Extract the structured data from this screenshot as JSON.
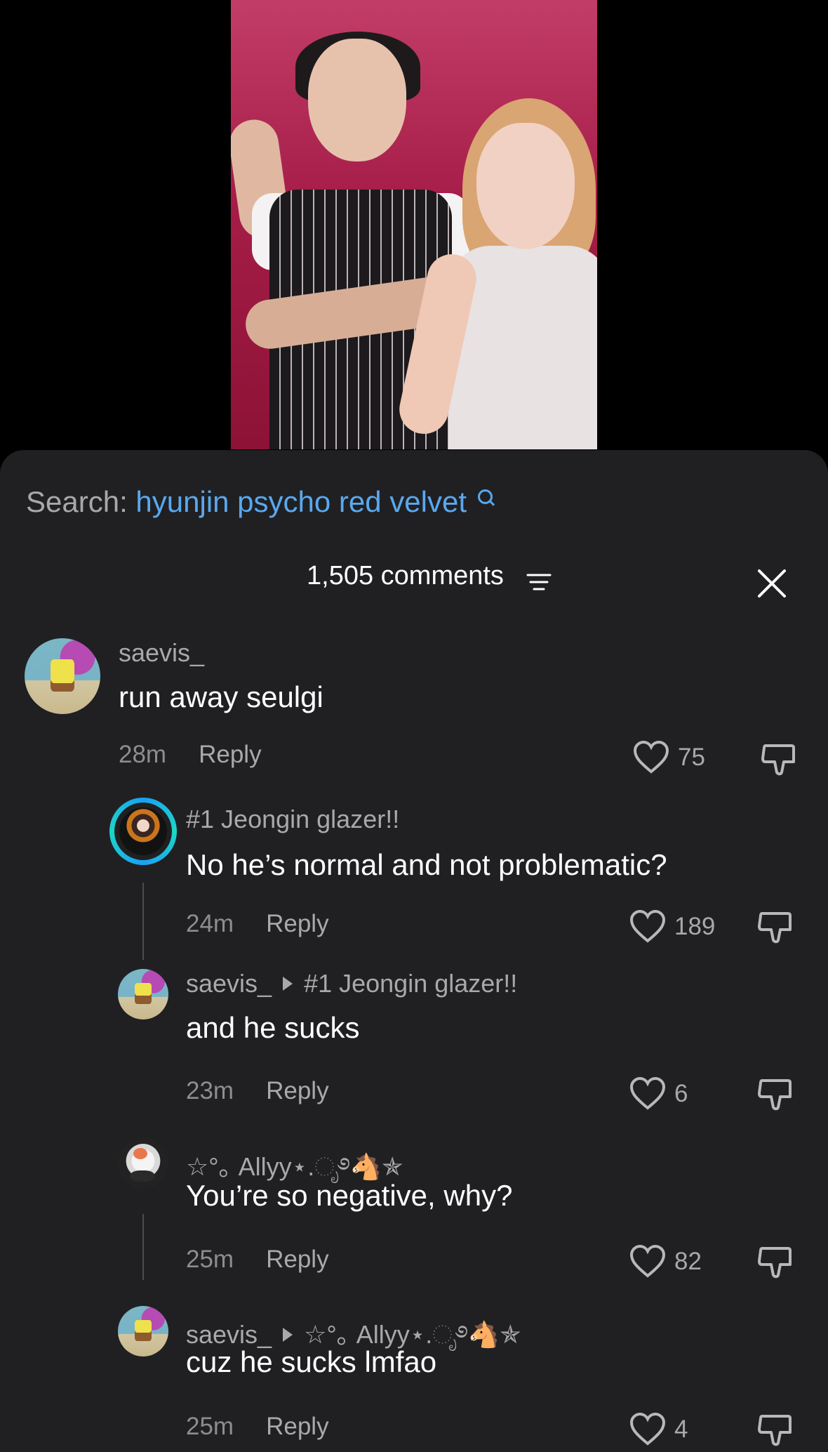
{
  "search": {
    "prefix": "Search:",
    "query": "hyunjin psycho red velvet"
  },
  "header": {
    "count": "1,505 comments"
  },
  "comments": [
    {
      "username": "saevis_",
      "text": "run away seulgi",
      "time": "28m",
      "reply": "Reply",
      "likes": "75"
    },
    {
      "username": "#1 Jeongin glazer!!",
      "text": "No he’s normal and not problematic?",
      "time": "24m",
      "reply": "Reply",
      "likes": "189"
    },
    {
      "username": "saevis_",
      "reply_to": "#1 Jeongin glazer!!",
      "text": "and he sucks",
      "time": "23m",
      "reply": "Reply",
      "likes": "6"
    },
    {
      "username": "☆°｡ Allyy⋆.ೃ࿔🐴✯",
      "text": "You’re so negative, why?",
      "time": "25m",
      "reply": "Reply",
      "likes": "82"
    },
    {
      "username": "saevis_",
      "reply_to": "☆°｡ Allyy⋆.ೃ࿔🐴✯",
      "text": "cuz he sucks lmfao",
      "time": "25m",
      "reply": "Reply",
      "likes": "4"
    }
  ],
  "icons": [
    "search-icon",
    "sort-icon",
    "close-icon",
    "heart-icon",
    "dislike-icon"
  ],
  "colors": {
    "sheet_bg": "#202022",
    "search_query": "#59a8ef",
    "muted_text": "#a9a9ab"
  }
}
